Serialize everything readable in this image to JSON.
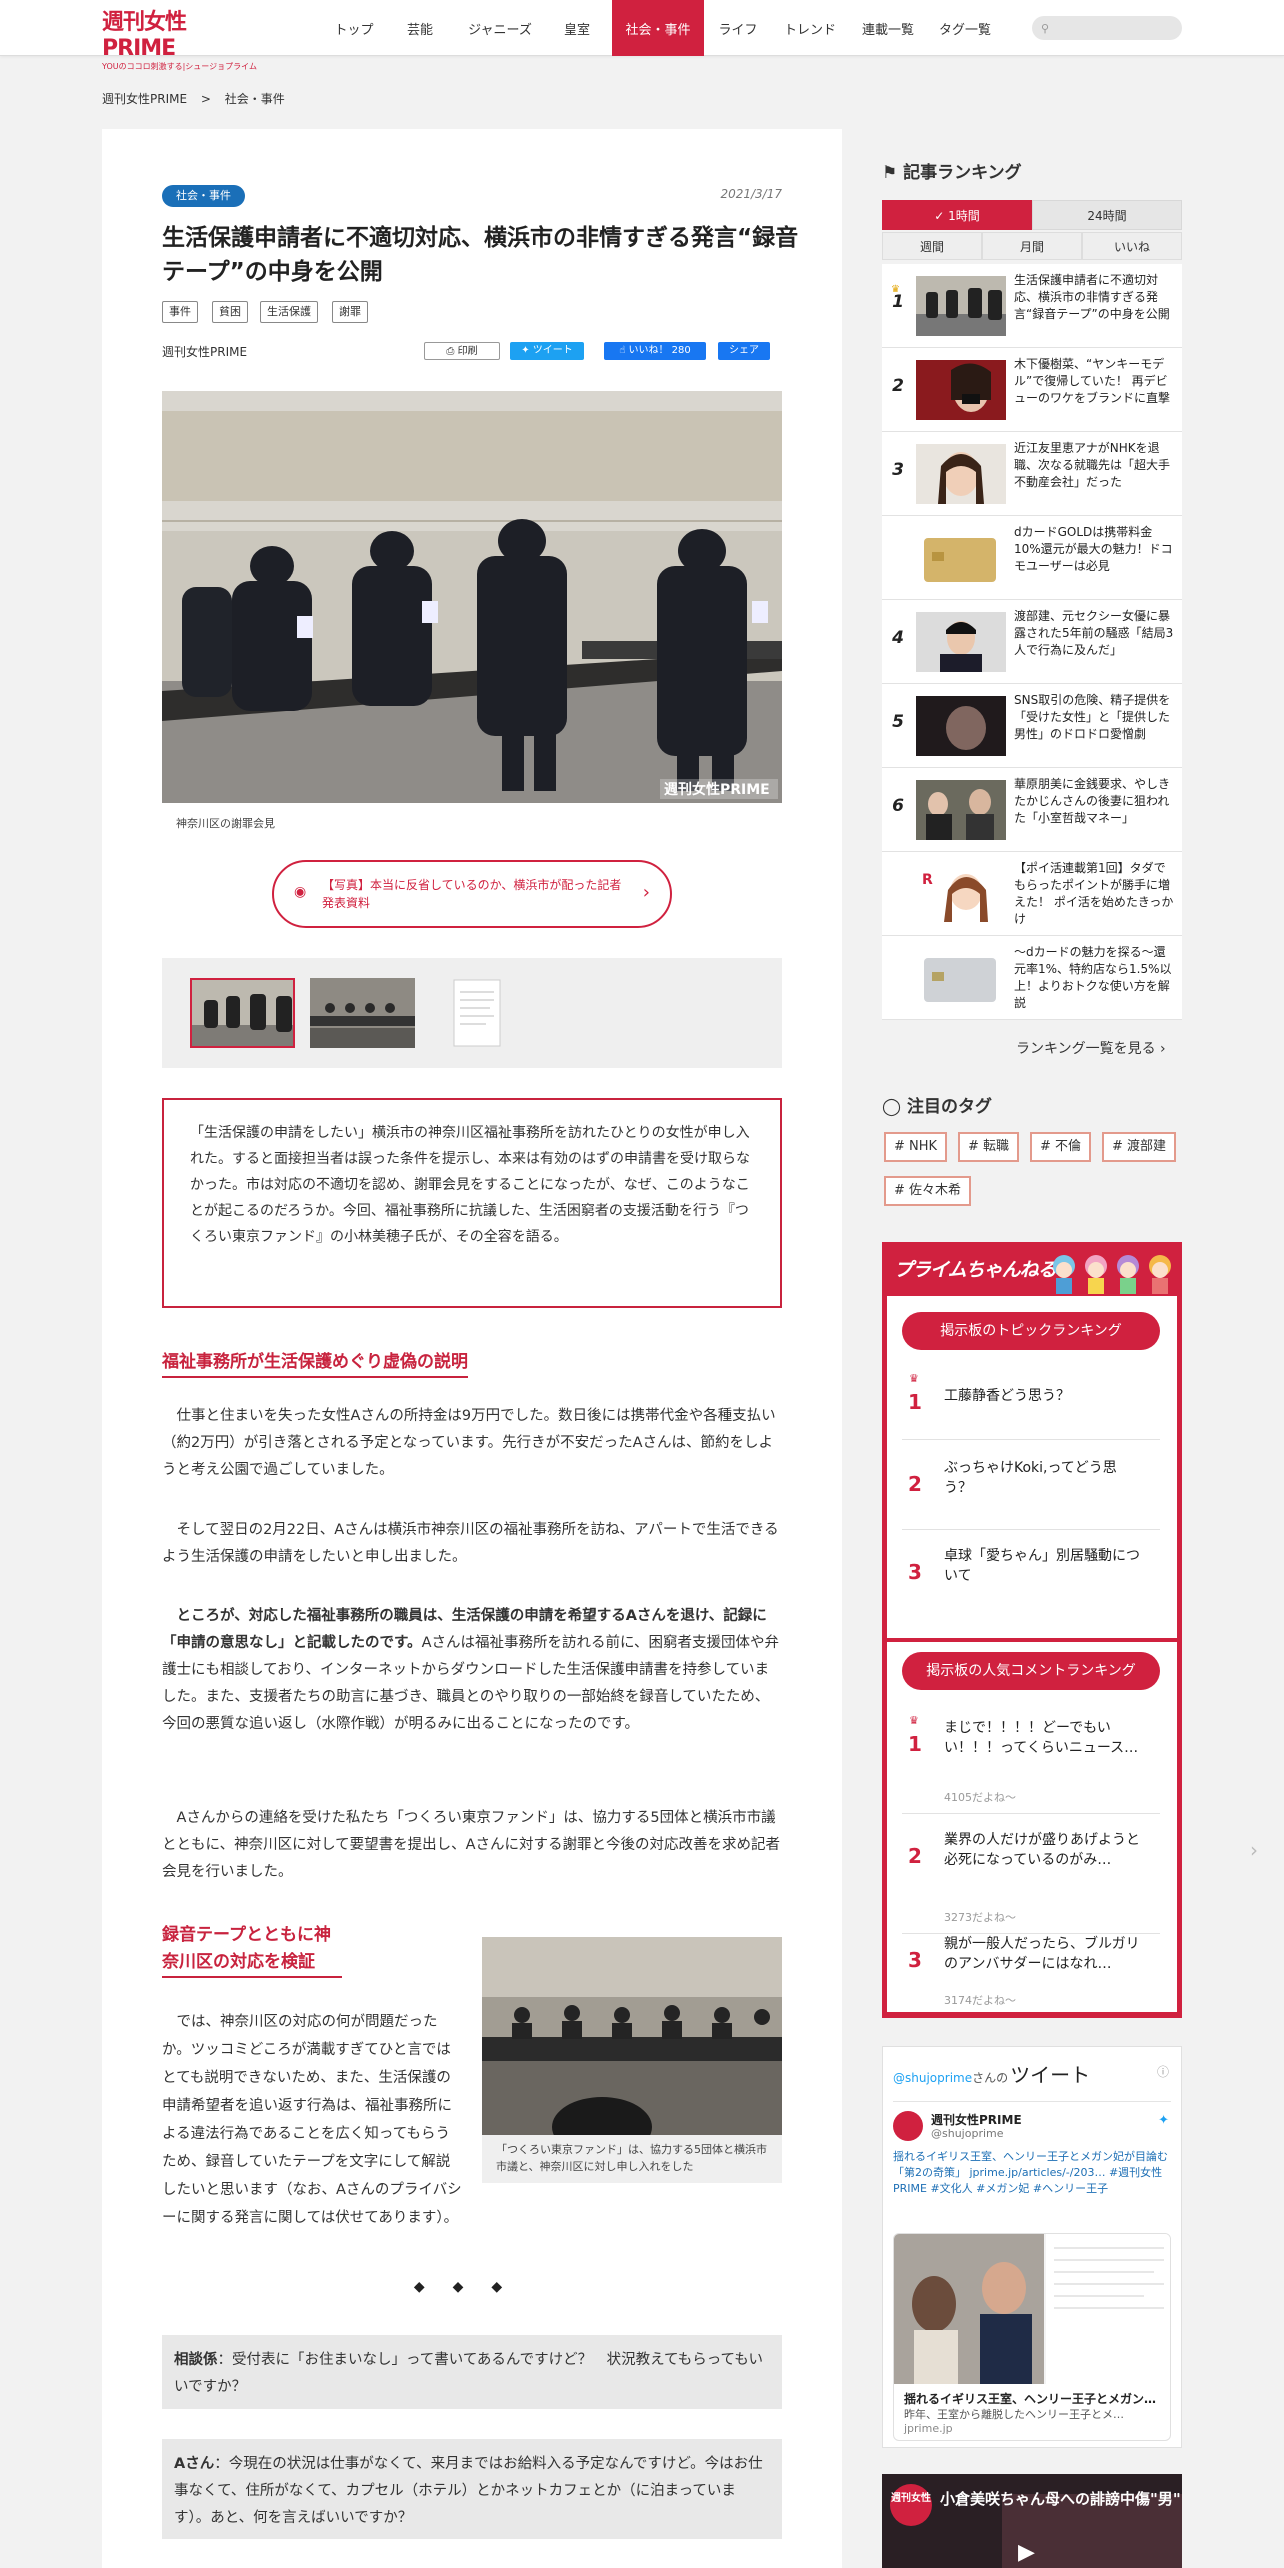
{
  "header": {
    "logo_title": "週刊女性PRIME",
    "logo_sub": "YOUのココロ刺激する|シュージョプライム",
    "nav": [
      "トップ",
      "芸能",
      "ジャニーズ",
      "皇室",
      "社会・事件",
      "ライフ",
      "トレンド",
      "連載一覧",
      "タグ一覧"
    ],
    "active_nav": "社会・事件",
    "search_placeholder": ""
  },
  "breadcrumb": [
    "週刊女性PRIME",
    ">",
    "社会・事件"
  ],
  "article": {
    "category": "社会・事件",
    "date": "2021/3/17",
    "title": "生活保護申請者に不適切対応、横浜市の非情すぎる発言“録音テープ”の中身を公開",
    "tags": [
      "事件",
      "貧困",
      "生活保護",
      "謝罪"
    ],
    "author": "週刊女性PRIME",
    "share": {
      "print": "印刷",
      "tweet": "ツイート",
      "like": "いいね！ 280",
      "share": "シェア"
    },
    "photo_watermark": "週刊女性PRIME",
    "photo_caption": "神奈川区の謝罪会見",
    "photo_link": "【写真】本当に反省しているのか、横浜市が配った記者発表資料",
    "lead": "「生活保護の申請をしたい」横浜市の神奈川区福祉事務所を訪れたひとりの女性が申し入れた。すると面接担当者は誤った条件を提示し、本来は有効のはずの申請書を受け取らなかった。市は対応の不適切を認め、謝罪会見をすることになったが、なぜ、このようなことが起こるのだろうか。今回、福祉事務所に抗議した、生活困窮者の支援活動を行う『つくろい東京ファンド』の小林美穂子氏が、その全容を語る。",
    "h2_1": "福祉事務所が生活保護めぐり虚偽の説明",
    "p1": "仕事と住まいを失った女性Aさんの所持金は9万円でした。数日後には携帯代金や各種支払い（約2万円）が引き落とされる予定となっています。先行きが不安だったAさんは、節約をしようと考え公園で過ごしていました。",
    "p2": "そして翌日の2月22日、Aさんは横浜市神奈川区の福祉事務所を訪ね、アパートで生活できるよう生活保護の申請をしたいと申し出ました。",
    "p3_bold": "ところが、対応した福祉事務所の職員は、生活保護の申請を希望するAさんを退け、記録に「申請の意思なし」と記載したのです。",
    "p3_rest": "Aさんは福祉事務所を訪れる前に、困窮者支援団体や弁護士にも相談しており、インターネットからダウンロードした生活保護申請書を持参していました。また、支援者たちの助言に基づき、職員とのやり取りの一部始終を録音していたため、今回の悪質な追い返し（水際作戦）が明るみに出ることになったのです。",
    "p4": "Aさんからの連絡を受けた私たち「つくろい東京ファンド」は、協力する5団体と横浜市市議とともに、神奈川区に対して要望書を提出し、Aさんに対する謝罪と今後の対応改善を求め記者会見を行いました。",
    "h2_2": "録音テープとともに神奈川区の対応を検証",
    "p5": "では、神奈川区の対応の何が問題だったか。ツッコミどころが満載すぎてひと言ではとても説明できないため、また、生活保護の申請希望者を追い返す行為は、福祉事務所による違法行為であることを広く知ってもらうため、録音していたテープを文字にして解説したいと思います（なお、Aさんのプライバシーに関する発言に関しては伏せてあります）。",
    "photo2_caption": "「つくろい東京ファンド」は、協力する5団体と横浜市市議と、神奈川区に対し申し入れをした",
    "dots": "◆◆◆",
    "q1_speaker": "相談係",
    "q1_text": "：受付表に「お住まいなし」って書いてあるんですけど？　状況教えてもらってもいいですか？",
    "q2_speaker": "Aさん",
    "q2_text": "：今現在の状況は仕事がなくて、来月まではお給料入る予定なんですけど。今はお仕事なくて、住所がなくて、カプセル（ホテル）とかネットカフェとか（に泊まっています）。あと、何を言えばいいですか？"
  },
  "ranking": {
    "title": "記事ランキング",
    "tabs": [
      "1時間",
      "24時間"
    ],
    "subtabs": [
      "週間",
      "月間",
      "いいね"
    ],
    "items": [
      {
        "rank": "1",
        "title": "生活保護申請者に不適切対応、横浜市の非情すぎる発言“録音テープ”の中身を公開"
      },
      {
        "rank": "2",
        "title": "木下優樹菜、“ヤンキーモデル”で復帰していた！ 再デビューのワケをブランドに直撃"
      },
      {
        "rank": "3",
        "title": "近江友里恵アナがNHKを退職、次なる就職先は「超大手不動産会社」だった"
      },
      {
        "rank": "",
        "title": "dカードGOLDは携帯料金10%還元が最大の魅力！ドコモユーザーは必見"
      },
      {
        "rank": "4",
        "title": "渡部建、元セクシー女優に暴露された5年前の騒惑「結局3人で行為に及んだ」"
      },
      {
        "rank": "5",
        "title": "SNS取引の危険、精子提供を「受けた女性」と「提供した男性」のドロドロ愛憎劇"
      },
      {
        "rank": "6",
        "title": "華原朋美に金銭要求、やしきたかじんさんの後妻に狙われた「小室哲哉マネー」"
      },
      {
        "rank": "",
        "title": "【ポイ活連載第1回】タダでもらったポイントが勝手に増えた！ ポイ活を始めたきっかけ"
      },
      {
        "rank": "",
        "title": "〜dカードの魅力を探る〜還元率1%、特約店なら1.5%以上！よりおトクな使い方を解説"
      }
    ],
    "more": "ランキング一覧を見る"
  },
  "tags_box": {
    "title": "注目のタグ",
    "tags": [
      "# NHK",
      "# 転職",
      "# 不倫",
      "# 渡部建",
      "# 佐々木希"
    ]
  },
  "channel": {
    "title": "プライムちゃんねる",
    "topic_button": "掲示板のトピックランキング",
    "topics": [
      {
        "rank": "1",
        "title": "工藤静香どう思う？"
      },
      {
        "rank": "2",
        "title": "ぶっちゃけKoki,ってどう思う？"
      },
      {
        "rank": "3",
        "title": "卓球「愛ちゃん」別居騒動について"
      }
    ],
    "comment_button": "掲示板の人気コメントランキング",
    "comments": [
      {
        "rank": "1",
        "title": "まじで！！！！どーでもいい！！！ってくらいニュース…",
        "likes": "4105だよね〜"
      },
      {
        "rank": "2",
        "title": "業界の人だけが盛りあげようと必死になっているのがみ…",
        "likes": "3273だよね〜"
      },
      {
        "rank": "3",
        "title": "親が一般人だったら、ブルガリのアンバサダーにはなれ…",
        "likes": "3174だよね〜"
      }
    ]
  },
  "twitter": {
    "handle": "@shujoprime",
    "handle_suffix": "さんの",
    "header": "ツイート",
    "account_name": "週刊女性PRIME",
    "account_handle": "@shujoprime",
    "tweet_text": "揺れるイギリス王室、ヘンリー王子とメガン妃が目論む「第2の奇策」 jprime.jp/articles/-/203… #週刊女性PRIME #文化人 #メガン妃 #ヘンリー王子",
    "card_title": "揺れるイギリス王室、ヘンリー王子とメガン…",
    "card_desc": "昨年、王室から離脱したヘンリー王子とメ…",
    "card_domain": "jprime.jp"
  },
  "video": {
    "channel_badge": "週刊女性",
    "title": "小倉美咲ちゃん母への誹謗中傷\"男\""
  }
}
